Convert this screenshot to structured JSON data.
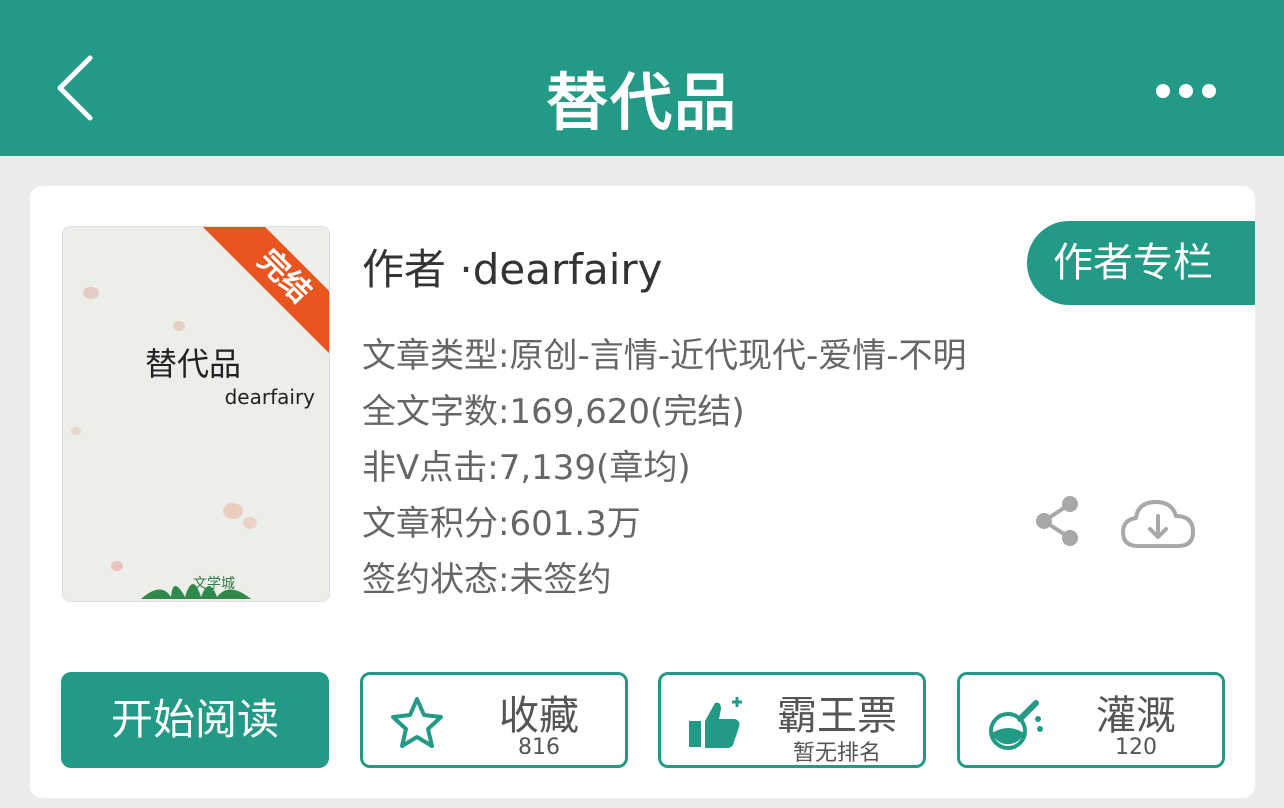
{
  "header": {
    "title": "替代品",
    "back_icon": "chevron-left-icon",
    "more_icon": "more-horizontal-icon"
  },
  "book": {
    "cover": {
      "title": "替代品",
      "author": "dearfairy",
      "badge": "完结",
      "logo_text": "文学城"
    },
    "author_line": "作者 ·dearfairy",
    "author_column_label": "作者专栏",
    "meta": [
      "文章类型:原创-言情-近代现代-爱情-不明",
      "全文字数:169,620(完结)",
      "非V点击:7,139(章均)",
      "文章积分:601.3万",
      "签约状态:未签约"
    ]
  },
  "actions": {
    "read_label": "开始阅读",
    "favorite": {
      "label": "收藏",
      "sub": "816",
      "icon": "star-icon"
    },
    "vote": {
      "label": "霸王票",
      "sub": "暂无排名",
      "icon": "thumbs-up-icon"
    },
    "water": {
      "label": "灌溉",
      "sub": "120",
      "icon": "flask-icon"
    },
    "share_icon": "share-icon",
    "download_icon": "cloud-download-icon"
  },
  "colors": {
    "accent": "#239a85",
    "badge": "#e8551f",
    "text_primary": "#333333",
    "text_secondary": "#666666"
  }
}
